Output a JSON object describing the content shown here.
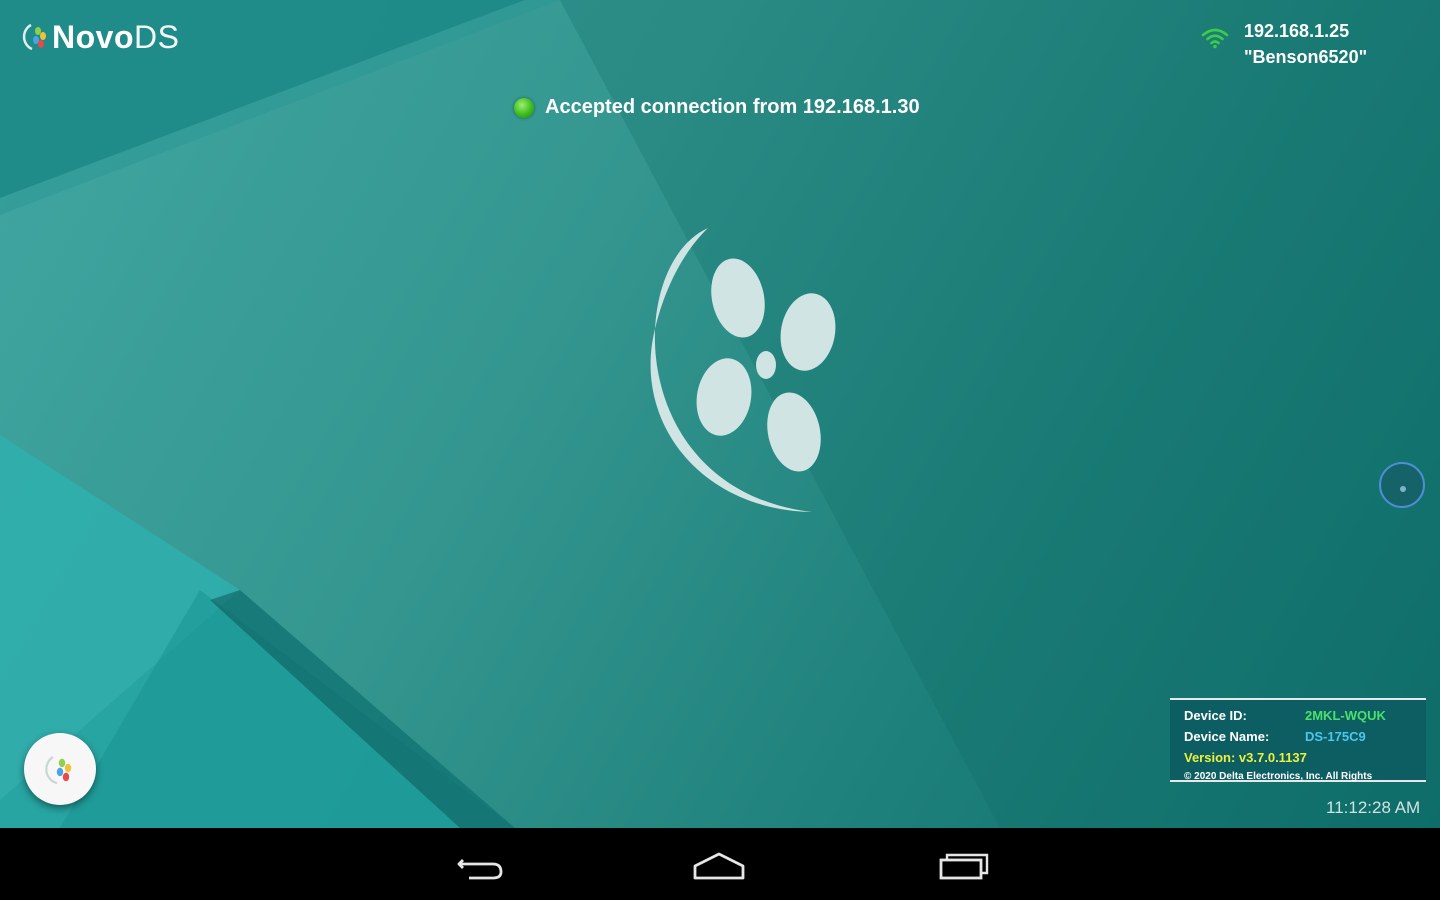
{
  "app": {
    "logo_text_bold": "Novo",
    "logo_text_light": "DS"
  },
  "network": {
    "ip": "192.168.1.25",
    "ssid": "\"Benson6520\""
  },
  "status": {
    "message": "Accepted connection from 192.168.1.30",
    "color": "#3dbb1c"
  },
  "device_info": {
    "id_label": "Device ID:",
    "id_value": "2MKL-WQUK",
    "name_label": "Device Name:",
    "name_value": "DS-175C9",
    "version_label": "Version:",
    "version_value": "v3.7.0.1137",
    "copyright": "© 2020 Delta Electronics, Inc. All Rights"
  },
  "clock": "11:12:28 AM",
  "icons": {
    "logo": "novods-logo-icon",
    "wifi": "wifi-icon",
    "emblem": "novods-emblem-icon",
    "launcher": "launcher-icon",
    "back": "back-icon",
    "home": "home-icon",
    "recents": "recents-icon"
  },
  "colors": {
    "teal_light": "#41a6a2",
    "teal_dark": "#0f6f6b",
    "device_id": "#4be06a",
    "device_name": "#4cc6ec",
    "version": "#eef03a"
  }
}
